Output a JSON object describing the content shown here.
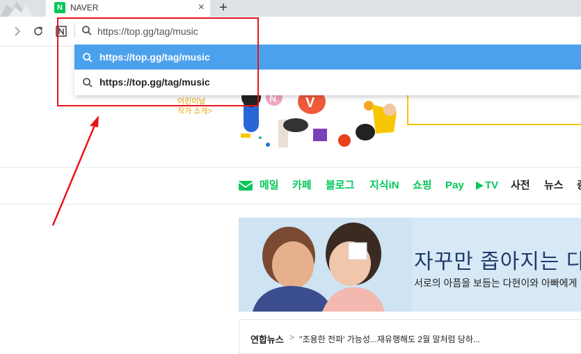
{
  "tab": {
    "favicon_letter": "N",
    "title": "NAVER",
    "close_glyph": "×",
    "new_tab_glyph": "+"
  },
  "toolbar": {
    "icons": [
      "forward-icon",
      "reload-icon",
      "naver-shortcut-icon",
      "search-icon"
    ],
    "shortcut_letter": "N",
    "address_value": "https://top.gg/tag/music"
  },
  "dropdown": {
    "items": [
      {
        "text": "https://top.gg/tag/music",
        "selected": true
      },
      {
        "text": "https://top.gg/tag/music",
        "selected": false
      }
    ]
  },
  "page": {
    "promo_line1": "어린이날",
    "promo_line2": "작가 소개>",
    "services": [
      {
        "label": "메일"
      },
      {
        "label": "카페"
      },
      {
        "label": "블로그"
      },
      {
        "label": "지식iN"
      },
      {
        "label": "쇼핑"
      },
      {
        "label": "Pay"
      },
      {
        "label": "TV"
      },
      {
        "label": "사전"
      },
      {
        "label": "뉴스"
      },
      {
        "label": "증"
      }
    ],
    "banner": {
      "title": "자꾸만 좁아지는 다",
      "subtitle": "서로의 아픔을 보듬는 다현이와 아빠에게"
    },
    "news": {
      "press": "연합뉴스",
      "chevron": ">",
      "headline": "''조용한 전파' 가능성...재유행해도 2월 말처럼 당하..."
    }
  },
  "colors": {
    "naver_green": "#03c75a",
    "tab_strip": "#dee1e6",
    "dropdown_highlight": "#4ca1ed",
    "annotation_red": "#e8141c",
    "banner_bg": "#d7e9f6"
  }
}
